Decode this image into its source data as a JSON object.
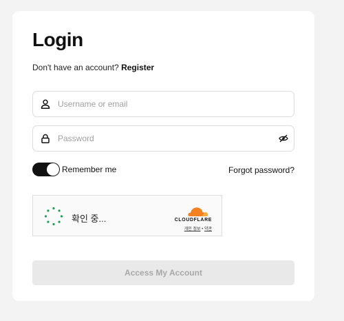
{
  "login": {
    "title": "Login",
    "no_account_text": "Don't have an account?",
    "register_link": "Register",
    "username_placeholder": "Username or email",
    "username_value": "",
    "password_placeholder": "Password",
    "password_value": "",
    "remember_me_label": "Remember me",
    "remember_me_on": true,
    "forgot_password_link": "Forgot password?",
    "submit_button": "Access My Account",
    "submit_enabled": false
  },
  "captcha": {
    "status_text": "확인 중...",
    "brand_name": "CLOUDFLARE",
    "privacy_link": "개인 정보",
    "separator": "•",
    "terms_link": "약관",
    "brand_color": "#f48120",
    "spinner_color": "#1f9d55"
  },
  "icons": {
    "username": "user-icon",
    "password": "lock-icon",
    "visibility": "eye-off-icon",
    "captcha": "spinner-icon",
    "cloudflare": "cloud-icon"
  }
}
